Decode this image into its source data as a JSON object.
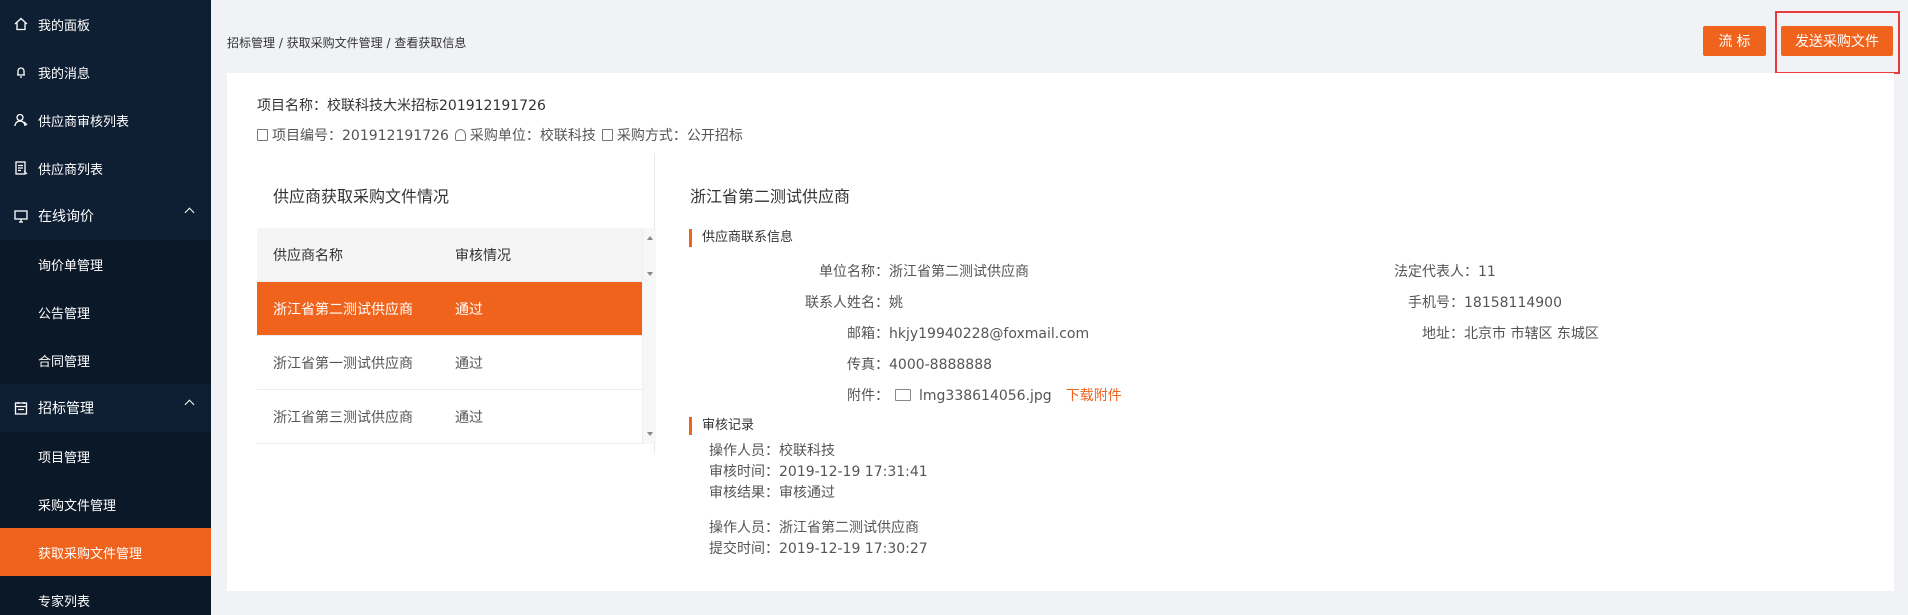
{
  "sidebar": {
    "items": [
      {
        "label": "我的面板",
        "icon": "home-icon"
      },
      {
        "label": "我的消息",
        "icon": "bell-icon"
      },
      {
        "label": "供应商审核列表",
        "icon": "user-check-icon"
      },
      {
        "label": "供应商列表",
        "icon": "doc-list-icon"
      }
    ],
    "group_inquiry": {
      "label": "在线询价",
      "icon": "monitor-icon",
      "children": [
        "询价单管理",
        "公告管理",
        "合同管理"
      ]
    },
    "group_bidding": {
      "label": "招标管理",
      "icon": "calendar-icon",
      "children": [
        "项目管理",
        "采购文件管理",
        "获取采购文件管理",
        "专家列表"
      ],
      "active": "获取采购文件管理"
    }
  },
  "breadcrumb": "招标管理 / 获取采购文件管理 / 查看获取信息",
  "buttons": {
    "flow": "流 标",
    "send": "发送采购文件"
  },
  "project": {
    "name_label": "项目名称：校联科技大米招标201912191726",
    "number": "项目编号：201912191726",
    "unit": "采购单位：校联科技",
    "method": "采购方式：公开招标"
  },
  "left_panel": {
    "title": "供应商获取采购文件情况",
    "headers": [
      "供应商名称",
      "审核情况"
    ],
    "rows": [
      [
        "浙江省第二测试供应商",
        "通过"
      ],
      [
        "浙江省第一测试供应商",
        "通过"
      ],
      [
        "浙江省第三测试供应商",
        "通过"
      ]
    ]
  },
  "right_panel": {
    "title": "浙江省第二测试供应商",
    "contact_section": "供应商联系信息",
    "unit_name": "单位名称：浙江省第二测试供应商",
    "legal_rep": "法定代表人：11",
    "contact_name": "联系人姓名：姚",
    "phone": "手机号：18158114900",
    "email": "邮箱：hkjy19940228@foxmail.com",
    "address": "地址：北京市 市辖区 东城区",
    "fax": "传真：4000-8888888",
    "attachment_label": "附件：",
    "attachment_file": "lmg338614056.jpg",
    "download": "下载附件",
    "review_section": "审核记录",
    "records": [
      [
        "操作人员：校联科技",
        "审核时间：2019-12-19 17:31:41",
        "审核结果：审核通过"
      ],
      [
        "操作人员：浙江省第二测试供应商",
        "提交时间：2019-12-19 17:30:27"
      ]
    ]
  },
  "colors": {
    "accent": "#f0631c",
    "sidebar": "#0e1e33",
    "highlight": "#e83a3a"
  }
}
